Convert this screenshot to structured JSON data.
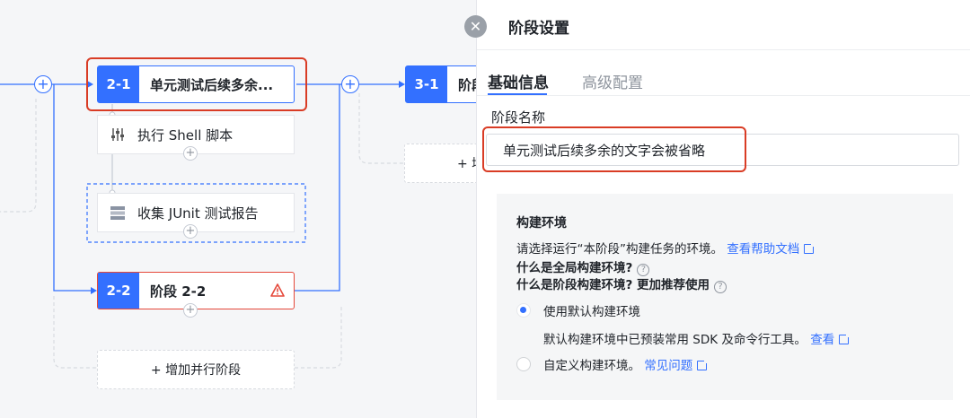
{
  "pipeline": {
    "stage_2_1": {
      "num": "2-1",
      "name": "单元测试后续多余..."
    },
    "stage_3_1": {
      "num": "3-1",
      "name": "阶段"
    },
    "stage_2_2": {
      "num": "2-2",
      "name": "阶段 2-2"
    },
    "task_shell": {
      "label": "执行 Shell 脚本",
      "icon": "sliders-icon"
    },
    "task_junit": {
      "label": "收集 JUnit 测试报告",
      "icon": "report-stack-icon"
    },
    "add_parallel_label": "+ 增加并行阶段",
    "add_parallel_right_label": "+ 增",
    "plus_symbol": "+",
    "warning_symbol": "!"
  },
  "panel": {
    "close_symbol": "✕",
    "title": "阶段设置",
    "tabs": [
      {
        "label": "基础信息",
        "active": true
      },
      {
        "label": "高级配置",
        "active": false
      }
    ],
    "stage_name_label": "阶段名称",
    "stage_name_value": "单元测试后续多余的文字会被省略",
    "env": {
      "title": "构建环境",
      "desc": "请选择运行“本阶段”构建任务的环境。",
      "help_link": "查看帮助文档",
      "q_global": "什么是全局构建环境?",
      "q_stage": "什么是阶段构建环境? 更加推荐使用",
      "q_symbol": "?",
      "option_default": "使用默认构建环境",
      "option_default_desc": "默认构建环境中已预装常用 SDK 及命令行工具。",
      "option_default_link": "查看",
      "option_custom": "自定义构建环境。",
      "option_custom_link": "常见问题",
      "selected": "option_default"
    }
  },
  "colors": {
    "accent": "#3370ff",
    "highlight": "#d93c25",
    "warning": "#e5483a"
  }
}
